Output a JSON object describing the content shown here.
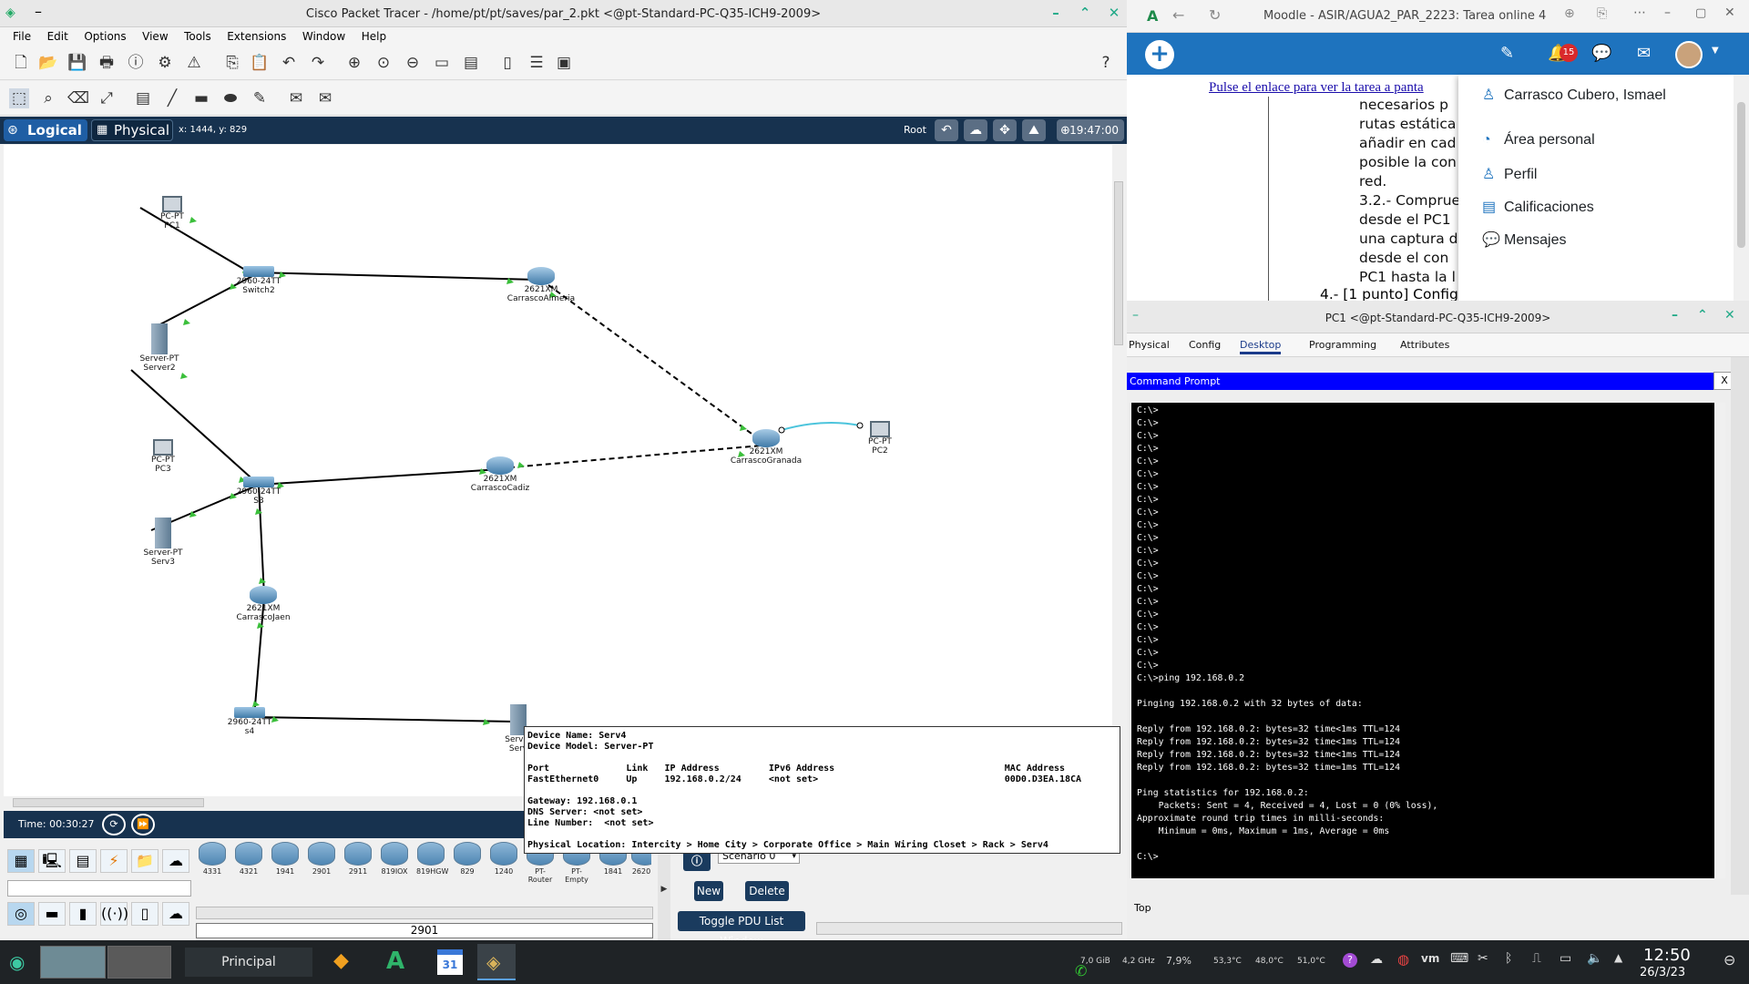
{
  "pt": {
    "title": "Cisco Packet Tracer - /home/pt/pt/saves/par_2.pkt <@pt-Standard-PC-Q35-ICH9-2009>",
    "menu": [
      "File",
      "Edit",
      "Options",
      "View",
      "Tools",
      "Extensions",
      "Window",
      "Help"
    ],
    "tabs": {
      "logical": "Logical",
      "physical": "Physical"
    },
    "coords": "x: 1444, y: 829",
    "root": "Root",
    "clock": "19:47:00",
    "time_label": "Time: 00:30:27",
    "devices": [
      {
        "type": "pc",
        "l1": "PC-PT",
        "l2": "PC1"
      },
      {
        "type": "switch",
        "l1": "2960-24TT",
        "l2": "Switch2"
      },
      {
        "type": "server",
        "l1": "Server-PT",
        "l2": "Server2"
      },
      {
        "type": "router",
        "l1": "2621XM",
        "l2": "CarrascoAlmeria"
      },
      {
        "type": "pc",
        "l1": "PC-PT",
        "l2": "PC3"
      },
      {
        "type": "switch",
        "l1": "2960-24TT",
        "l2": "S3"
      },
      {
        "type": "server",
        "l1": "Server-PT",
        "l2": "Serv3"
      },
      {
        "type": "router",
        "l1": "2621XM",
        "l2": "CarrascoCadiz"
      },
      {
        "type": "router",
        "l1": "2621XM",
        "l2": "CarrascoGranada"
      },
      {
        "type": "pc",
        "l1": "PC-PT",
        "l2": "PC2"
      },
      {
        "type": "router",
        "l1": "2621XM",
        "l2": "CarrascoJaen"
      },
      {
        "type": "switch",
        "l1": "2960-24TT",
        "l2": "s4"
      },
      {
        "type": "server",
        "l1": "Server",
        "l2": "Serv"
      }
    ],
    "tooltip": "Device Name: Serv4\nDevice Model: Server-PT\n\nPort              Link   IP Address         IPv6 Address                               MAC Address\nFastEthernet0     Up     192.168.0.2/24     <not set>                                  00D0.D3EA.18CA\n\nGateway: 192.168.0.1\nDNS Server: <not set>\nLine Number:  <not set>\n\nPhysical Location: Intercity > Home City > Corporate Office > Main Wiring Closet > Rack > Serv4",
    "models": [
      "4331",
      "4321",
      "1941",
      "2901",
      "2911",
      "819IOX",
      "819HGW",
      "829",
      "1240",
      "PT-Router",
      "PT-Empty",
      "1841",
      "2620"
    ],
    "model_selected": "2901",
    "scenario": "Scenario 0",
    "buttons": {
      "new": "New",
      "delete": "Delete",
      "toggle_pdu": "Toggle PDU List Window"
    }
  },
  "browser": {
    "title": "Moodle - ASIR/AGUA2_PAR_2223: Tarea online 4",
    "notif_count": "15",
    "link": "Pulse el enlace para ver la tarea a panta",
    "lines": [
      "necesarios  p",
      "rutas estática",
      "añadir en cad",
      "posible la con",
      "red.",
      "3.2.- Comprue",
      "desde el PC1",
      "una captura d",
      "desde el con",
      "PC1 hasta la l"
    ],
    "line_last": "4.- [1 punto] Config",
    "user_menu": [
      {
        "icon": "user-icon",
        "label": "Carrasco Cubero, Ismael"
      },
      {
        "icon": "dashboard-icon",
        "label": "Área personal"
      },
      {
        "icon": "profile-icon",
        "label": "Perfil"
      },
      {
        "icon": "grades-icon",
        "label": "Calificaciones"
      },
      {
        "icon": "messages-icon",
        "label": "Mensajes"
      }
    ]
  },
  "pc1": {
    "title": "PC1 <@pt-Standard-PC-Q35-ICH9-2009>",
    "tabs": [
      "Physical",
      "Config",
      "Desktop",
      "Programming",
      "Attributes"
    ],
    "active_tab": "Desktop",
    "cmd_title": "Command Prompt",
    "cmd_close": "X",
    "cmd_output": "C:\\>\nC:\\>\nC:\\>\nC:\\>\nC:\\>\nC:\\>\nC:\\>\nC:\\>\nC:\\>\nC:\\>\nC:\\>\nC:\\>\nC:\\>\nC:\\>\nC:\\>\nC:\\>\nC:\\>\nC:\\>\nC:\\>\nC:\\>\nC:\\>\nC:\\>ping 192.168.0.2\n\nPinging 192.168.0.2 with 32 bytes of data:\n\nReply from 192.168.0.2: bytes=32 time<1ms TTL=124\nReply from 192.168.0.2: bytes=32 time<1ms TTL=124\nReply from 192.168.0.2: bytes=32 time<1ms TTL=124\nReply from 192.168.0.2: bytes=32 time=1ms TTL=124\n\nPing statistics for 192.168.0.2:\n    Packets: Sent = 4, Received = 4, Lost = 0 (0% loss),\nApproximate round trip times in milli-seconds:\n    Minimum = 0ms, Maximum = 1ms, Average = 0ms\n\nC:\\>",
    "top_label": "Top"
  },
  "taskbar": {
    "principal": "Principal",
    "calendar_day": "31",
    "tray": [
      "7,0 GiB",
      "4,2 GHz",
      "7,9%",
      "53,3°C",
      "48,0°C",
      "51,0°C"
    ],
    "time": "12:50",
    "date": "26/3/23"
  }
}
